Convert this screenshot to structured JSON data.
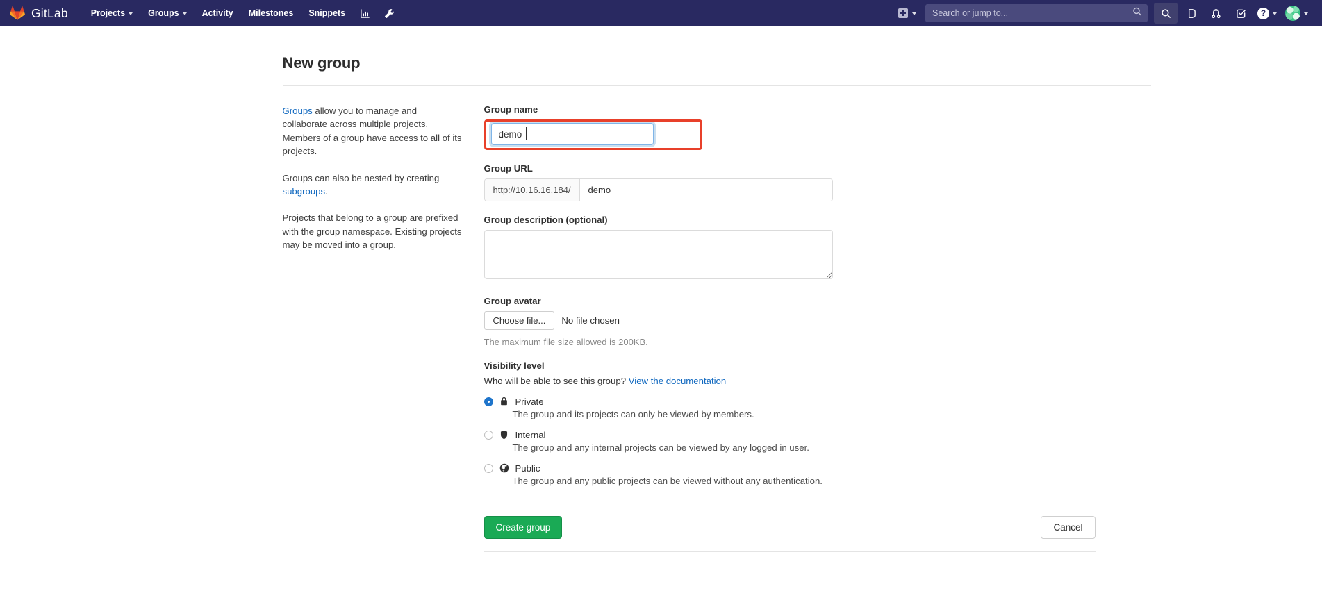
{
  "navbar": {
    "brand": "GitLab",
    "brand_logo_icon": "gitlab-tanuki-icon",
    "items": [
      {
        "label": "Projects",
        "has_caret": true
      },
      {
        "label": "Groups",
        "has_caret": true
      },
      {
        "label": "Activity",
        "has_caret": false
      },
      {
        "label": "Milestones",
        "has_caret": false
      },
      {
        "label": "Snippets",
        "has_caret": false
      }
    ],
    "icon_buttons": [
      {
        "name": "analytics-icon"
      },
      {
        "name": "wrench-icon"
      }
    ],
    "new_dropdown": {
      "icon": "plus-square-icon",
      "has_caret": true
    },
    "search": {
      "placeholder": "Search or jump to...",
      "value": "",
      "icon": "search-icon"
    },
    "right_icons": [
      {
        "name": "search-icon",
        "active": true
      },
      {
        "name": "issues-icon",
        "active": false
      },
      {
        "name": "merge-requests-icon",
        "active": false
      },
      {
        "name": "todos-icon",
        "active": false
      }
    ],
    "help": {
      "icon": "question-circle-icon",
      "has_caret": true
    },
    "user": {
      "icon": "avatar",
      "has_caret": true
    },
    "bg_color": "#292961"
  },
  "page": {
    "title": "New group"
  },
  "aside": {
    "p1_link": "Groups",
    "p1_rest": " allow you to manage and collaborate across multiple projects. Members of a group have access to all of its projects.",
    "p2_pre": "Groups can also be nested by creating ",
    "p2_link": "subgroups",
    "p2_post": ".",
    "p3": "Projects that belong to a group are prefixed with the group namespace. Existing projects may be moved into a group."
  },
  "form": {
    "group_name": {
      "label": "Group name",
      "value": "demo",
      "placeholder": "",
      "focused": true,
      "annotation_color": "#e8402a"
    },
    "group_url": {
      "label": "Group URL",
      "prefix": "http://10.16.16.184/",
      "value": "demo"
    },
    "group_description": {
      "label": "Group description (optional)",
      "value": "",
      "placeholder": ""
    },
    "group_avatar": {
      "label": "Group avatar",
      "choose_button": "Choose file...",
      "status": "No file chosen",
      "hint": "The maximum file size allowed is 200KB."
    },
    "visibility": {
      "label": "Visibility level",
      "question": "Who will be able to see this group?",
      "doc_link": "View the documentation",
      "options": [
        {
          "name": "Private",
          "icon": "lock-icon",
          "selected": true,
          "description": "The group and its projects can only be viewed by members."
        },
        {
          "name": "Internal",
          "icon": "shield-icon",
          "selected": false,
          "description": "The group and any internal projects can be viewed by any logged in user."
        },
        {
          "name": "Public",
          "icon": "globe-icon",
          "selected": false,
          "description": "The group and any public projects can be viewed without any authentication."
        }
      ]
    },
    "actions": {
      "submit": "Create group",
      "submit_color": "#1aaa55",
      "cancel": "Cancel"
    }
  }
}
